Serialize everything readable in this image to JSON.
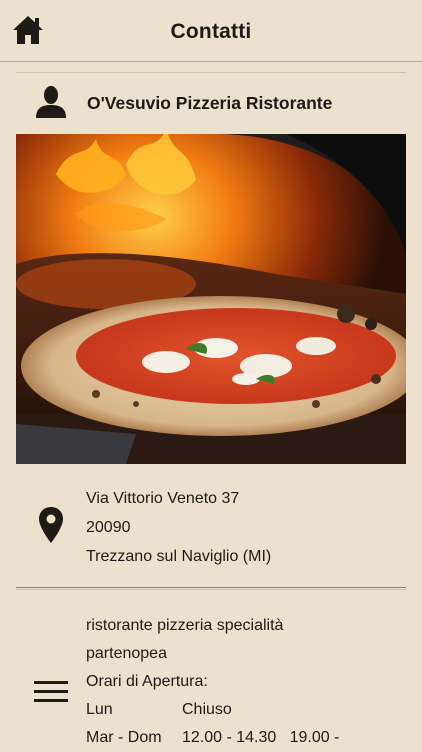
{
  "nav": {
    "title": "Contatti",
    "home_icon": "home-icon"
  },
  "contact": {
    "name": "O'Vesuvio Pizzeria Ristorante",
    "person_icon": "person-icon"
  },
  "photo": {
    "subject": "pizza-in-wood-fired-oven"
  },
  "address": {
    "icon": "map-pin-icon",
    "street": "Via Vittorio Veneto 37",
    "zip": "20090",
    "city": "Trezzano sul Naviglio (MI)"
  },
  "info": {
    "icon": "menu-icon",
    "description_line1": "ristorante pizzeria specialità",
    "description_line2": "partenopea",
    "hours_title": "Orari di Apertura:",
    "hours": [
      {
        "day": "Lun",
        "value": "Chiuso"
      },
      {
        "day": "Mar - Dom",
        "value": "12.00 - 14.30   19.00 -"
      }
    ]
  },
  "colors": {
    "background": "#ece1cd",
    "text": "#1e1a16",
    "divider": "#8f8470"
  }
}
